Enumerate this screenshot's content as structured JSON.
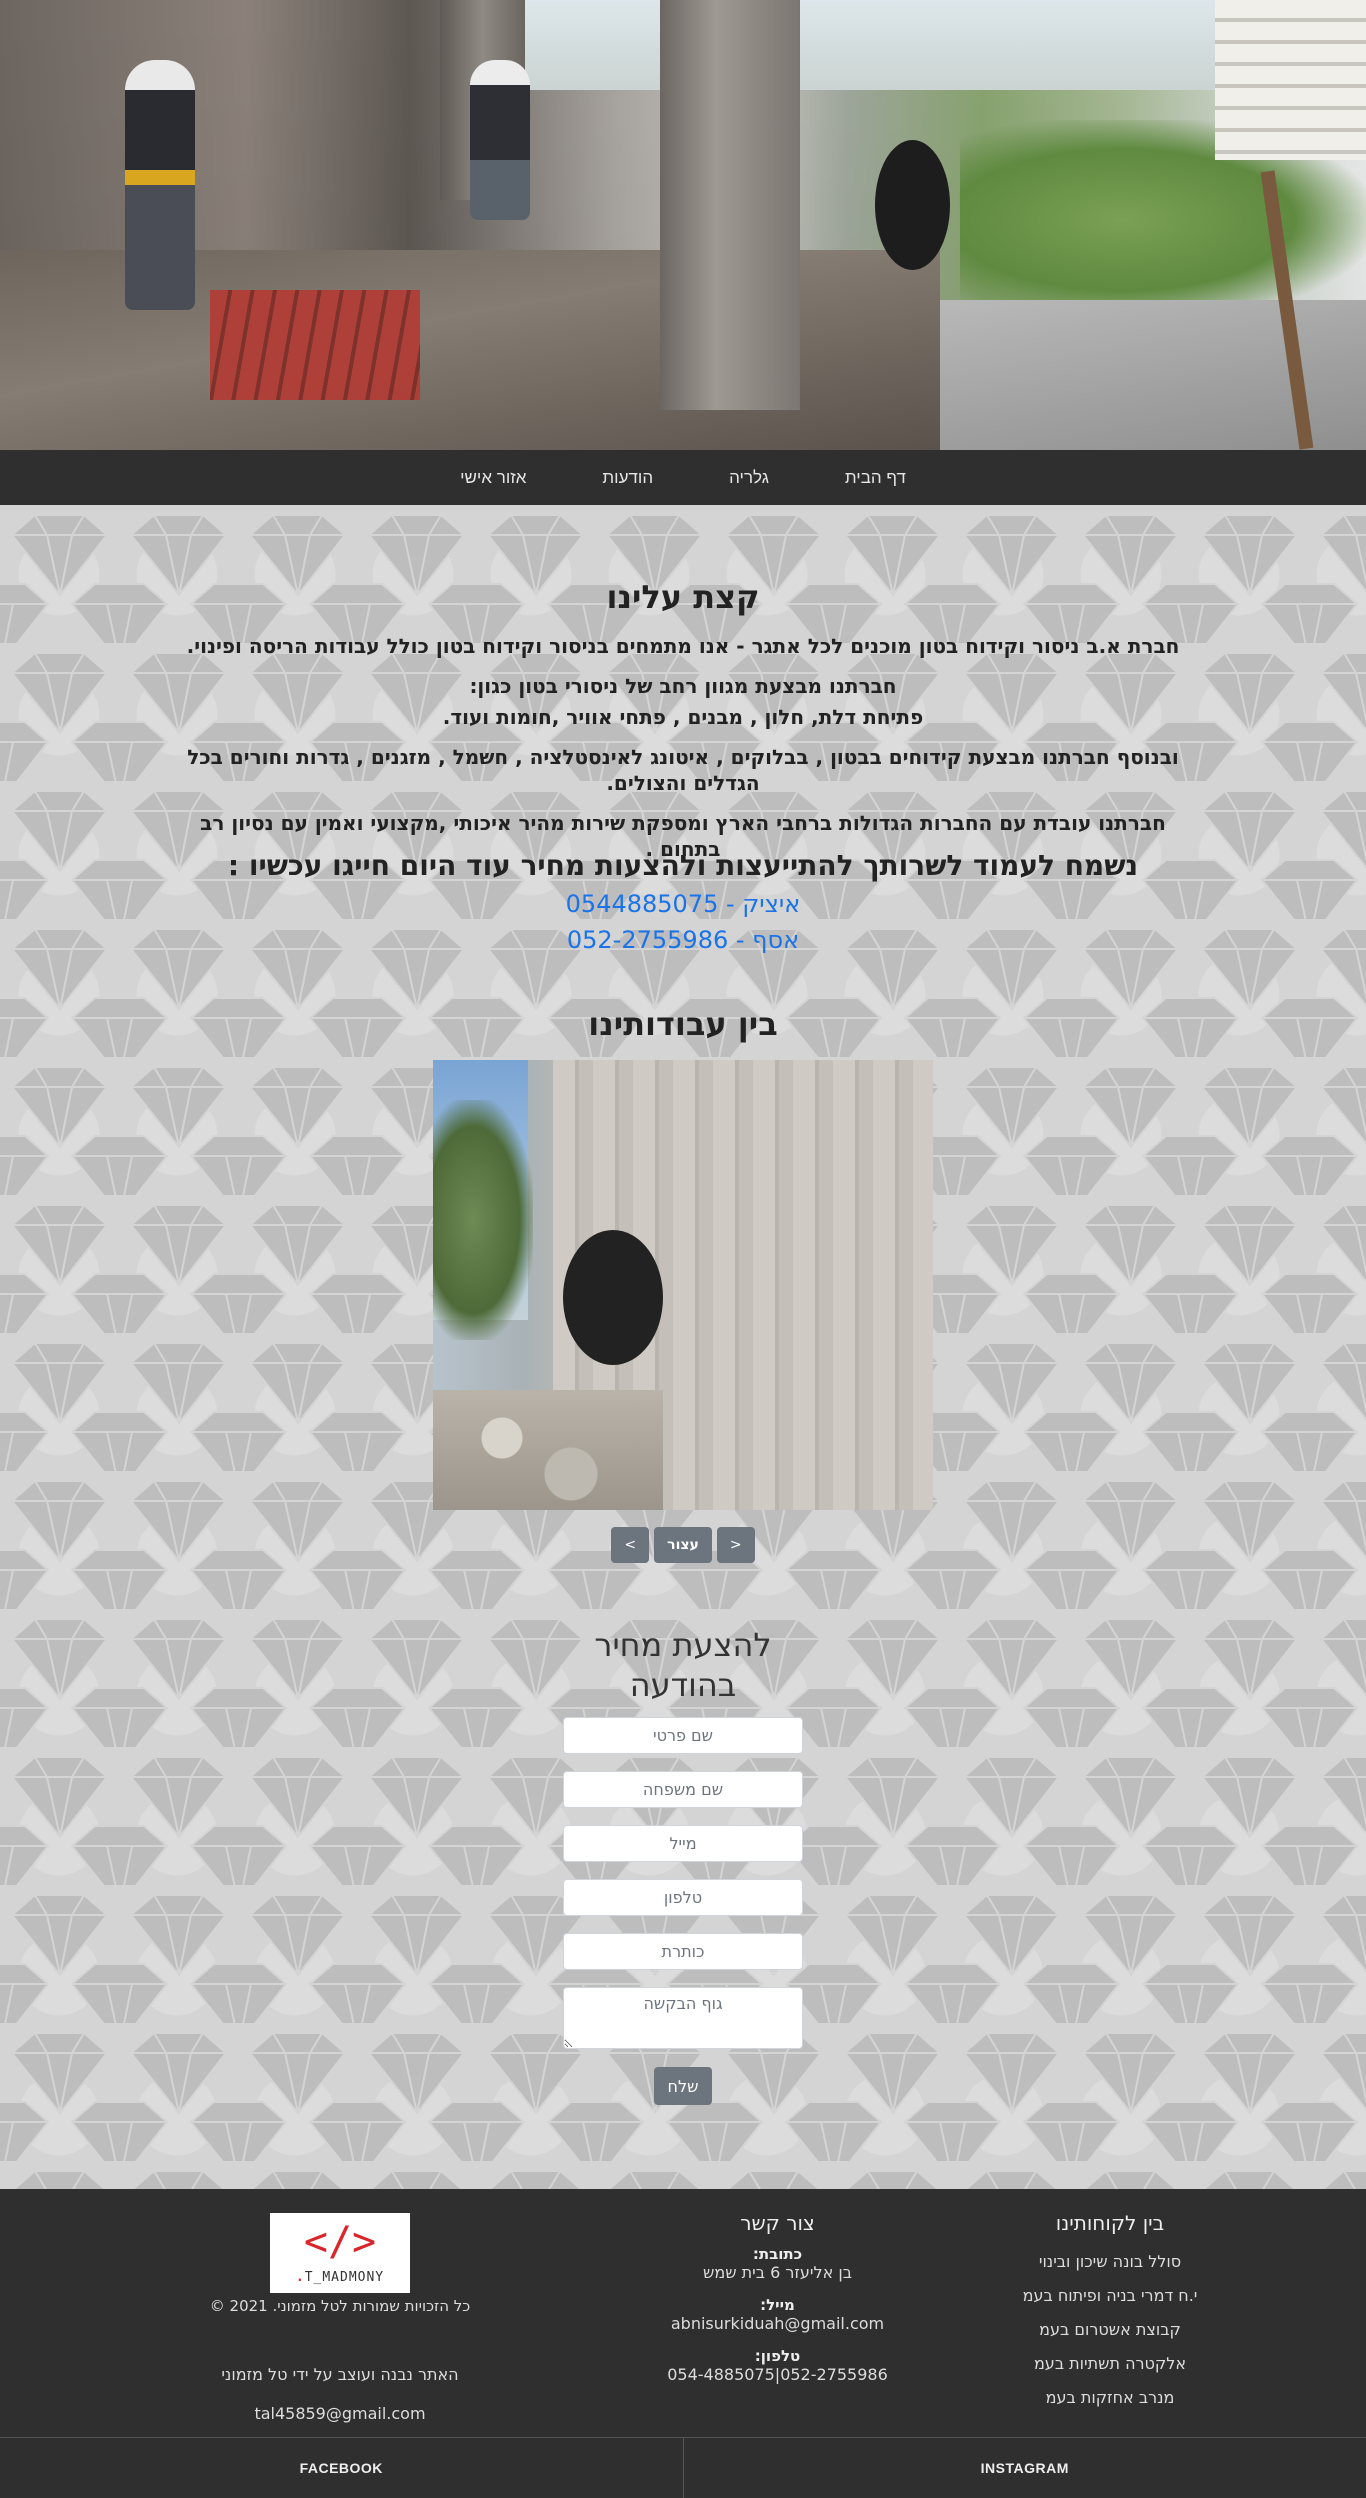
{
  "nav": {
    "items": [
      {
        "label": "דף הבית"
      },
      {
        "label": "גלריה"
      },
      {
        "label": "הודעות"
      },
      {
        "label": "אזור אישי"
      }
    ]
  },
  "about": {
    "title": "קצת עלינו",
    "line1": "חברת א.ב ניסור וקידוח בטון מוכנים לכל אתגר - אנו מתמחים בניסור וקידוח בטון כולל עבודות הריסה ופינוי.",
    "line2": "חברתנו מבצעת מגוון רחב של ניסורי בטון כגון:",
    "line3": "פתיחת דלת, חלון , מבנים , פתחי אוויר ,חומות ועוד.",
    "line4": "ובנוסף חברתנו מבצעת קידוחים בבטון , בבלוקים , איטונג לאינסטלציה , חשמל , מזגנים , גדרות וחורים בכל הגדלים והצולים.",
    "line5": "חברתנו עובדת עם החברות הגדולות ברחבי הארץ ומספקת שירות מהיר איכותי ,מקצועי ואמין עם נסיון רב בתחום .",
    "invite": "נשמח לעמוד לשרותך להתייעצות ולהצעות מחיר עוד היום חייגו עכשיו :",
    "phone1": "איציק - 0544885075",
    "phone2": "אסף - 052-2755986"
  },
  "gallery": {
    "title": "בין עבודותינו",
    "prev_label": "<",
    "pause_label": "עצור",
    "next_label": ">"
  },
  "form": {
    "title_line1": "להצעת מחיר",
    "title_line2": "בהודעה",
    "first_name_placeholder": "שם פרטי",
    "last_name_placeholder": "שם משפחה",
    "email_placeholder": "מייל",
    "phone_placeholder": "טלפון",
    "subject_placeholder": "כותרת",
    "body_placeholder": "גוף הבקשה",
    "send_label": "שלח"
  },
  "footer": {
    "clients_title": "בין לקוחותינו",
    "clients": [
      "סולל בונה שיכון ובינוי",
      "י.ח דמרי בניה ופיתוח בעמ",
      "קבוצת אשטרום בעמ",
      "אלקטרה תשתיות בעמ",
      "מנרב אחזקות בעמ"
    ],
    "contact_title": "צור קשר",
    "address_label": "כתובת:",
    "address": "בן אליעזר 6 בית שמש",
    "email_label": "מייל:",
    "email": "abnisurkiduah@gmail.com",
    "phone_label": "טלפון:",
    "phones": "052-2755986|054-4885075",
    "logo_text": "T_MADMONY",
    "logo_dot": ".",
    "copyright": "כל הזכויות שמורות לטל מזמוני.  2021  ©",
    "built_by": "האתר נבנה ועוצב על ידי טל מזמוני",
    "builder_email": "tal45859@gmail.com"
  },
  "social": {
    "facebook": "FACEBOOK",
    "instagram": "INSTAGRAM"
  }
}
